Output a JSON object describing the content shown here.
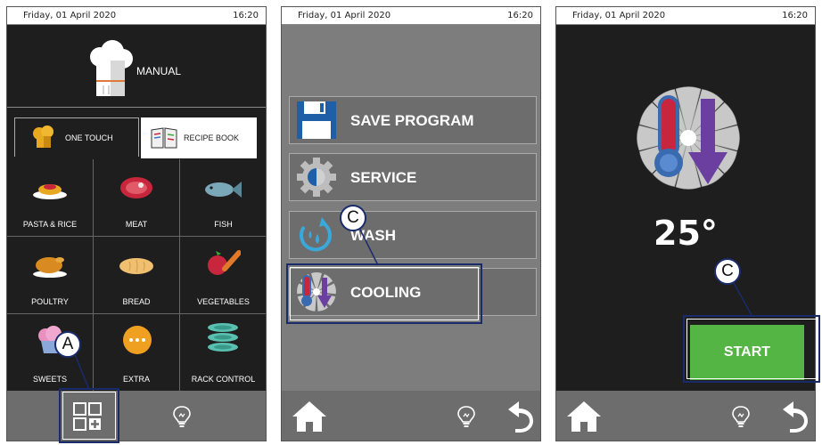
{
  "status": {
    "date": "Friday, 01 April 2020",
    "time": "16:20"
  },
  "panel1": {
    "manual": "MANUAL",
    "tab_one_touch": "ONE TOUCH",
    "tab_recipe_book": "RECIPE BOOK",
    "categories": [
      "PASTA & RICE",
      "MEAT",
      "FISH",
      "POULTRY",
      "BREAD",
      "VEGETABLES",
      "SWEETS",
      "EXTRA",
      "RACK CONTROL"
    ]
  },
  "panel2": {
    "items": [
      "SAVE PROGRAM",
      "SERVICE",
      "WASH",
      "COOLING"
    ]
  },
  "panel3": {
    "temperature": "25°",
    "start": "START"
  },
  "callouts": {
    "a": "A",
    "c1": "C",
    "c2": "C"
  },
  "colors": {
    "start_green": "#55b544",
    "callout_border": "#1a2b6b",
    "thermo_red": "#c8263c",
    "arrow_purple": "#6b3fa0",
    "save_blue": "#1f5fa8"
  }
}
